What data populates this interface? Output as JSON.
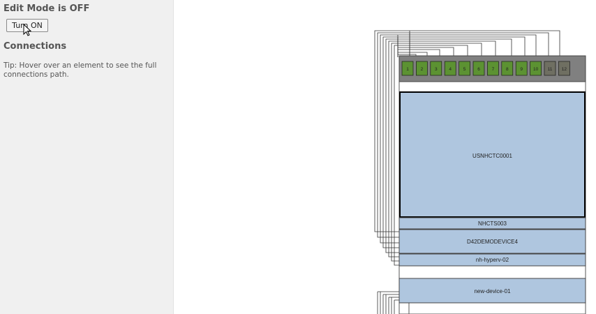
{
  "sidebar": {
    "edit_mode_title": "Edit Mode is OFF",
    "turn_on_label": "Turn ON",
    "connections_title": "Connections",
    "tip": "Tip: Hover over an element to see the full connections path."
  },
  "patch_panel": {
    "ports": [
      {
        "label": "1",
        "status": "active"
      },
      {
        "label": "2",
        "status": "active"
      },
      {
        "label": "3",
        "status": "active"
      },
      {
        "label": "4",
        "status": "active"
      },
      {
        "label": "5",
        "status": "active"
      },
      {
        "label": "6",
        "status": "active"
      },
      {
        "label": "7",
        "status": "active"
      },
      {
        "label": "8",
        "status": "active"
      },
      {
        "label": "9",
        "status": "active"
      },
      {
        "label": "10",
        "status": "active"
      },
      {
        "label": "11",
        "status": "inactive"
      },
      {
        "label": "12",
        "status": "inactive"
      }
    ],
    "colors": {
      "active": "#5c9232",
      "inactive": "#6f6f62",
      "frame": "#808080"
    }
  },
  "devices": [
    {
      "name": "USNHCTC0001"
    },
    {
      "name": "NHCTS003"
    },
    {
      "name": "D42DEMODEVICE4"
    },
    {
      "name": "nh-hyperv-02"
    },
    {
      "name": "new-device-01"
    }
  ],
  "colors": {
    "device_fill": "#afc6df",
    "sidebar_bg": "#f0f0f0"
  }
}
